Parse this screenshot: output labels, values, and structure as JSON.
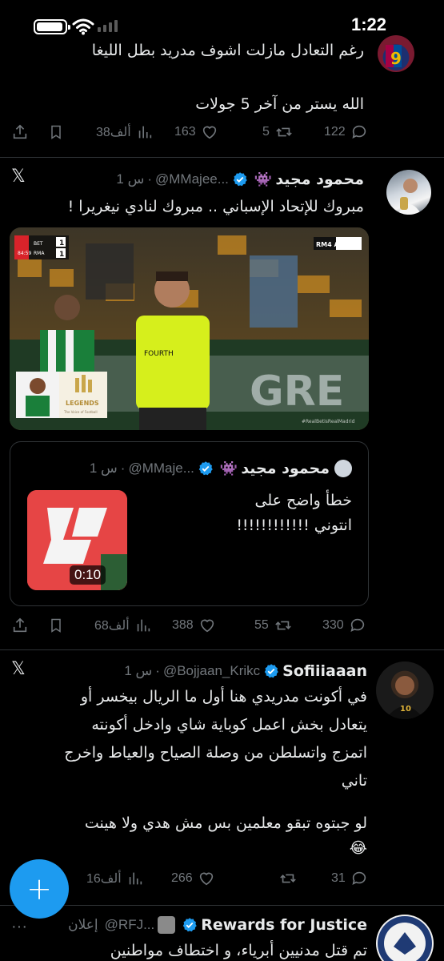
{
  "status_bar": {
    "time": "1:22",
    "icons": [
      "battery-icon",
      "wifi-icon",
      "cellular-signal-icon"
    ]
  },
  "tweet0": {
    "line1": "رغم التعادل مازلت اشوف مدريد بطل الليغا",
    "line2": "الله يستر من آخر 5 جولات",
    "actions": {
      "replies": "122",
      "retweets": "5",
      "likes": "163",
      "views": "38ألف"
    }
  },
  "tweet1": {
    "display_name": "محمود مجيد",
    "emoji": "👾",
    "handle": "@MMajee...",
    "time": "1 س",
    "text": "مبروك للإتحاد الإسباني .. مبروك لنادي نيغريرا !",
    "media": {
      "scoreboard": {
        "team1": "BET",
        "team2": "RMA",
        "score1": "1",
        "score2": "1",
        "clock": "84:59"
      },
      "channel": "RM4 Arab",
      "legends_title": "LEGENDS",
      "legends_sub": "The Voice of Football",
      "board_text": "GRE",
      "hashtag": "#RealBetisRealMadrid",
      "ref_shirt": "FOURTH"
    },
    "quote": {
      "display_name": "محمود مجيد",
      "emoji": "👾",
      "handle": "@MMaje...",
      "time": "1 س",
      "line1": "خطأ واضح على",
      "line2": "انتوني !!!!!!!!!!!!",
      "video_duration": "0:10"
    },
    "actions": {
      "replies": "330",
      "retweets": "55",
      "likes": "388",
      "views": "68ألف"
    }
  },
  "tweet2": {
    "display_name": "Sofiiiaaan",
    "handle": "@Bojjaan_Krikc",
    "time": "1 س",
    "lines": [
      "في أكونت مدريدي هنا أول ما الريال بيخسر أو",
      "يتعادل بخش اعمل كوباية شاي وادخل أكونته",
      "اتمزج واتسلطن من وصلة الصياح والعياط واخرج",
      "تاني",
      "",
      "لو جبتوه تبقو معلمين بس مش هدي ولا هينت",
      "😂"
    ],
    "actions": {
      "replies": "31",
      "retweets": "",
      "likes": "266",
      "views": "16ألف"
    }
  },
  "tweet3": {
    "display_name": "Rewards for Justice",
    "handle": "@RFJ...",
    "ad_label": "إعلان",
    "text": "تم قتل مدنيين أبرياء، و اختطاف مواطنين"
  },
  "fab": {
    "label": "+"
  }
}
